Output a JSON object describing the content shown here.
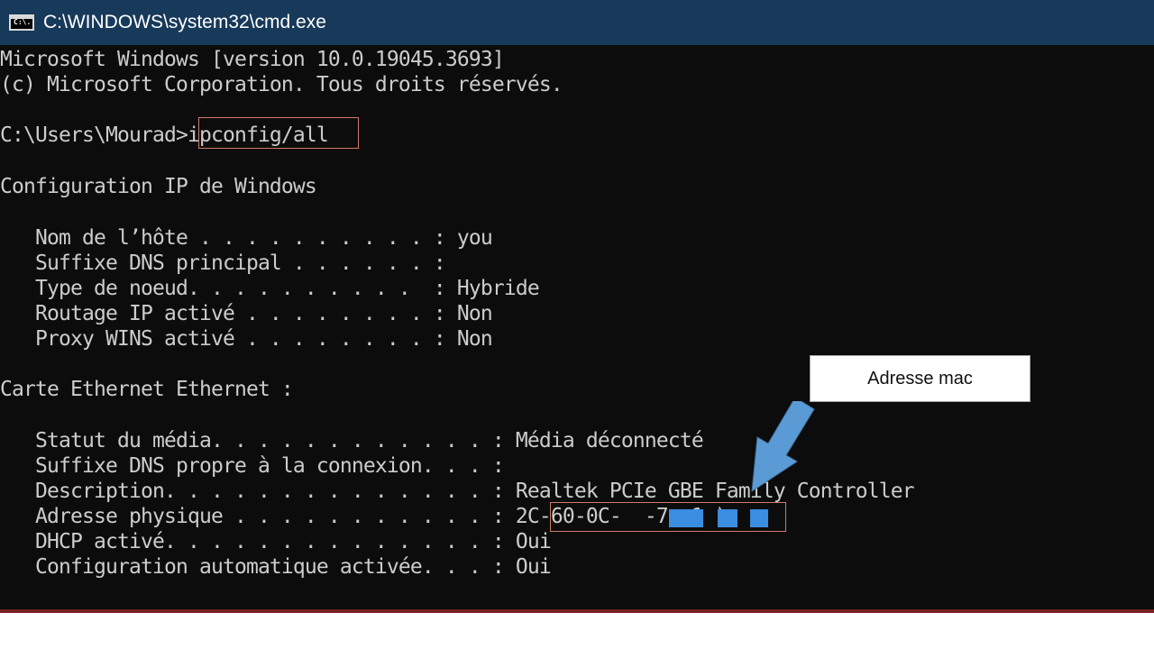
{
  "window": {
    "title": "C:\\WINDOWS\\system32\\cmd.exe",
    "icon": "cmd-icon",
    "icon_text": "C:\\."
  },
  "console": {
    "lines": [
      "Microsoft Windows [version 10.0.19045.3693]",
      "(c) Microsoft Corporation. Tous droits réservés.",
      "",
      "C:\\Users\\Mourad>ipconfig/all",
      "",
      "Configuration IP de Windows",
      "",
      "   Nom de l’hôte . . . . . . . . . . : you",
      "   Suffixe DNS principal . . . . . . :",
      "   Type de noeud. . . . . . . . . .  : Hybride",
      "   Routage IP activé . . . . . . . . : Non",
      "   Proxy WINS activé . . . . . . . . : Non",
      "",
      "Carte Ethernet Ethernet :",
      "",
      "   Statut du média. . . . . . . . . . . . : Média déconnecté",
      "   Suffixe DNS propre à la connexion. . . :",
      "   Description. . . . . . . . . . . . . . : Realtek PCIe GBE Family Controller",
      "   Adresse physique . . . . . . . . . . . : 2C-60-0C-  -7 -1 )",
      "   DHCP activé. . . . . . . . . . . . . . : Oui",
      "   Configuration automatique activée. . . : Oui"
    ]
  },
  "annotation": {
    "label": "Adresse mac",
    "fill_color": "#5b9bd5",
    "highlight_color": "#d07a6a"
  }
}
